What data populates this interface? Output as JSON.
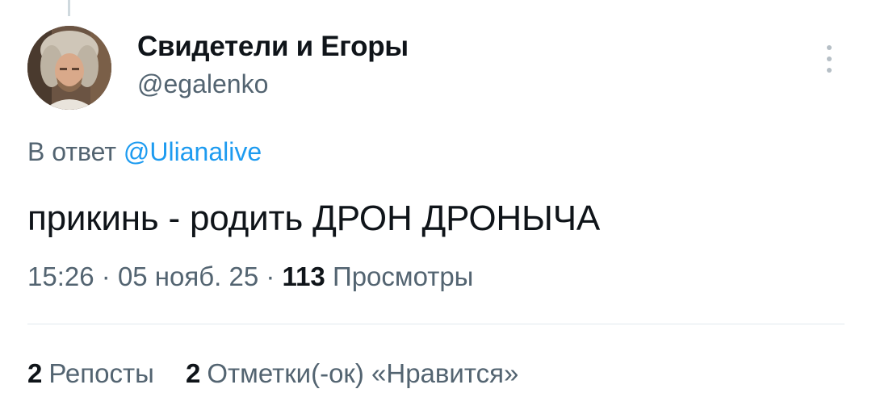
{
  "tweet": {
    "author": {
      "display_name": "Свидетели и Егоры",
      "handle": "@egalenko"
    },
    "reply_to": {
      "prefix": "В ответ",
      "mention": "@Ulianalive"
    },
    "text": "прикинь - родить ДРОН ДРОНЫЧА",
    "meta": {
      "time": "15:26",
      "separator": "·",
      "date": "05 нояб. 25",
      "views_count": "113",
      "views_label": "Просмотры"
    },
    "stats": {
      "reposts_count": "2",
      "reposts_label": "Репосты",
      "likes_count": "2",
      "likes_label": "Отметки(-ок) «Нравится»"
    }
  },
  "icons": {
    "more": "more-vertical-icon",
    "avatar": "avatar-photo"
  },
  "colors": {
    "text_primary": "#0f1419",
    "text_secondary": "#536471",
    "link": "#1d9bf0",
    "divider": "#e1e8ed"
  }
}
